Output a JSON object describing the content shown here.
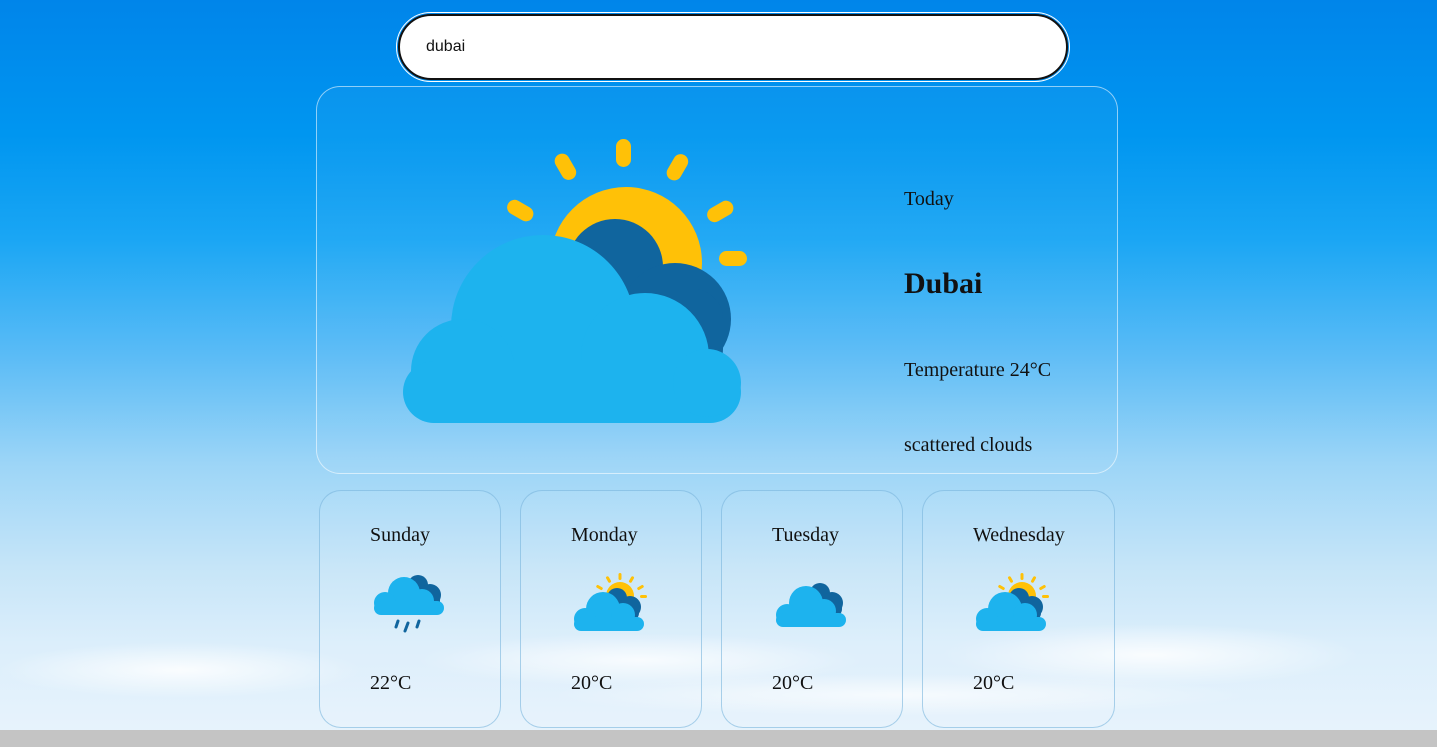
{
  "search": {
    "value": "dubai",
    "placeholder": ""
  },
  "current": {
    "label": "Today",
    "city": "Dubai",
    "temperature": "Temperature 24°C",
    "description": "scattered clouds",
    "icon": "sun-behind-clouds-icon"
  },
  "forecast": [
    {
      "day": "Sunday",
      "temp": "22°C",
      "icon": "rain-cloud-icon"
    },
    {
      "day": "Monday",
      "temp": "20°C",
      "icon": "sun-behind-clouds-icon"
    },
    {
      "day": "Tuesday",
      "temp": "20°C",
      "icon": "cloudy-icon"
    },
    {
      "day": "Wednesday",
      "temp": "20°C",
      "icon": "sun-behind-clouds-icon"
    }
  ],
  "colors": {
    "sun": "#ffc107",
    "cloud_light": "#1db3ee",
    "cloud_dark": "#10659e",
    "rain": "#10659e"
  }
}
